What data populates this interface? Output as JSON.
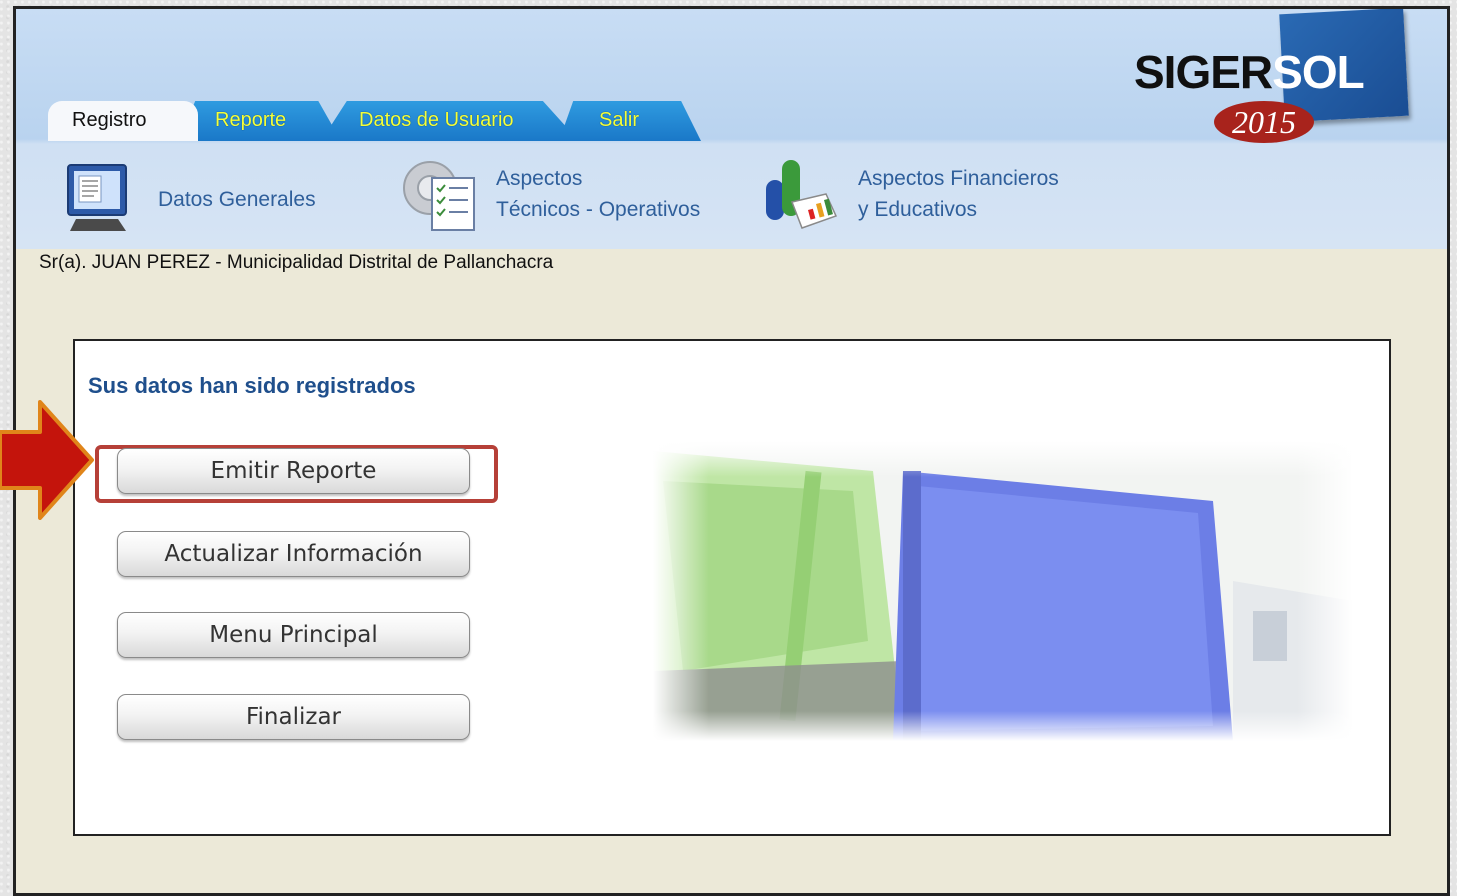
{
  "tabs": [
    {
      "label": "Registro"
    },
    {
      "label": "Reporte"
    },
    {
      "label": "Datos de Usuario"
    },
    {
      "label": "Salir"
    }
  ],
  "logo": {
    "name_dark": "SIGER",
    "name_light": "SOL",
    "year": "2015"
  },
  "subnav": {
    "datos_generales": "Datos Generales",
    "aspectos_tecnicos_1": "Aspectos",
    "aspectos_tecnicos_2": "Técnicos - Operativos",
    "aspectos_financieros_1": "Aspectos Financieros",
    "aspectos_financieros_2": "y Educativos"
  },
  "greeting": "Sr(a). JUAN PEREZ - Municipalidad Distrital de Pallanchacra",
  "panel": {
    "title": "Sus datos han sido registrados",
    "buttons": {
      "emitir": "Emitir Reporte",
      "actualizar": "Actualizar Información",
      "menu": "Menu Principal",
      "finalizar": "Finalizar"
    }
  },
  "colors": {
    "accent_tab": "#1a78c8",
    "tab_text": "#f4ff3a",
    "nav_text": "#2f5f9b",
    "highlight": "#b64038",
    "arrow": "#c4140c"
  }
}
